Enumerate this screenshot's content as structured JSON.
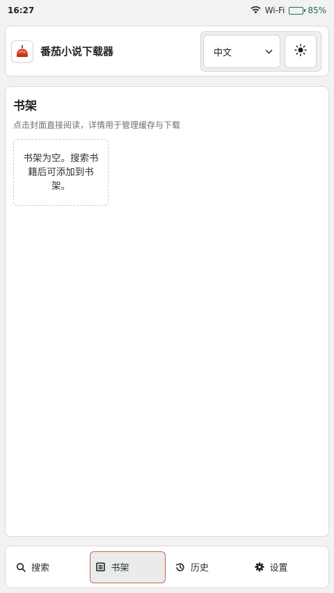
{
  "status_bar": {
    "time": "16:27",
    "network_label": "Wi-Fi",
    "battery_percent": "85%",
    "battery_level": 0.85,
    "wifi_icon": "wifi-icon",
    "battery_icon": "battery-icon"
  },
  "header": {
    "app_title": "番茄小说下载器",
    "app_icon": "tomato-logo-icon",
    "language_selected": "中文",
    "theme_icon": "sun-icon"
  },
  "bookshelf": {
    "title": "书架",
    "subtitle": "点击封面直接阅读，详情用于管理缓存与下载",
    "empty_message": "书架为空。搜索书籍后可添加到书架。"
  },
  "nav": {
    "items": [
      {
        "label": "搜索",
        "icon": "search-icon"
      },
      {
        "label": "书架",
        "icon": "book-icon"
      },
      {
        "label": "历史",
        "icon": "history-icon"
      },
      {
        "label": "设置",
        "icon": "gear-icon"
      }
    ],
    "active_index": 1
  },
  "colors": {
    "accent": "#c9654a",
    "battery_green": "#1f6b52"
  }
}
